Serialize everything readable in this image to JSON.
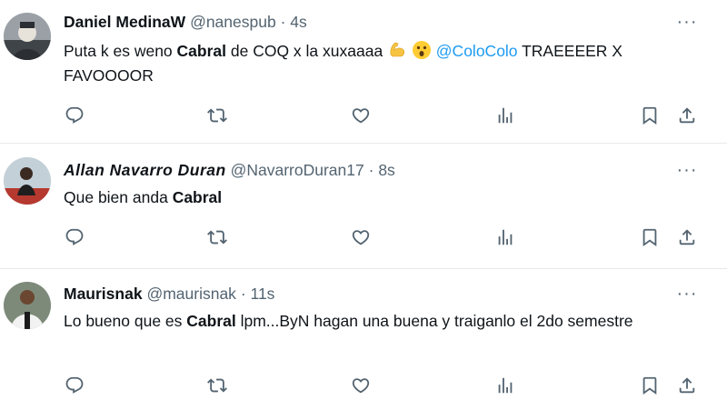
{
  "tweets": [
    {
      "name": "Daniel MedinaW",
      "handle": "@nanespub",
      "separator": "·",
      "time": "4s",
      "more": "···",
      "text_1": "Puta k es weno ",
      "bold": "Cabral",
      "text_2": " de COQ x la xuxaaaa ",
      "emojis": [
        "flexed-biceps-emoji",
        "astonished-face-emoji"
      ],
      "mention": "@ColoColo",
      "text_3": " TRAEEEER X FAVOOOOR"
    },
    {
      "name": "Allan Navarro Duran",
      "handle": "@NavarroDuran17",
      "separator": "·",
      "time": "8s",
      "more": "···",
      "text_1": "Que bien anda ",
      "bold": "Cabral",
      "text_2": ""
    },
    {
      "name": "Maurisnak",
      "handle": "@maurisnak",
      "separator": "·",
      "time": "11s",
      "more": "···",
      "text_1": "Lo bueno que es ",
      "bold": "Cabral",
      "text_2": " lpm...ByN hagan una buena y traiganlo el 2do semestre"
    }
  ],
  "action_icons": [
    "reply-icon",
    "retweet-icon",
    "like-icon",
    "views-icon",
    "bookmark-icon",
    "share-icon"
  ],
  "colors": {
    "text": "#0f1419",
    "secondary": "#536471",
    "mention": "#1d9bf0",
    "divider": "#e6e9ec"
  }
}
